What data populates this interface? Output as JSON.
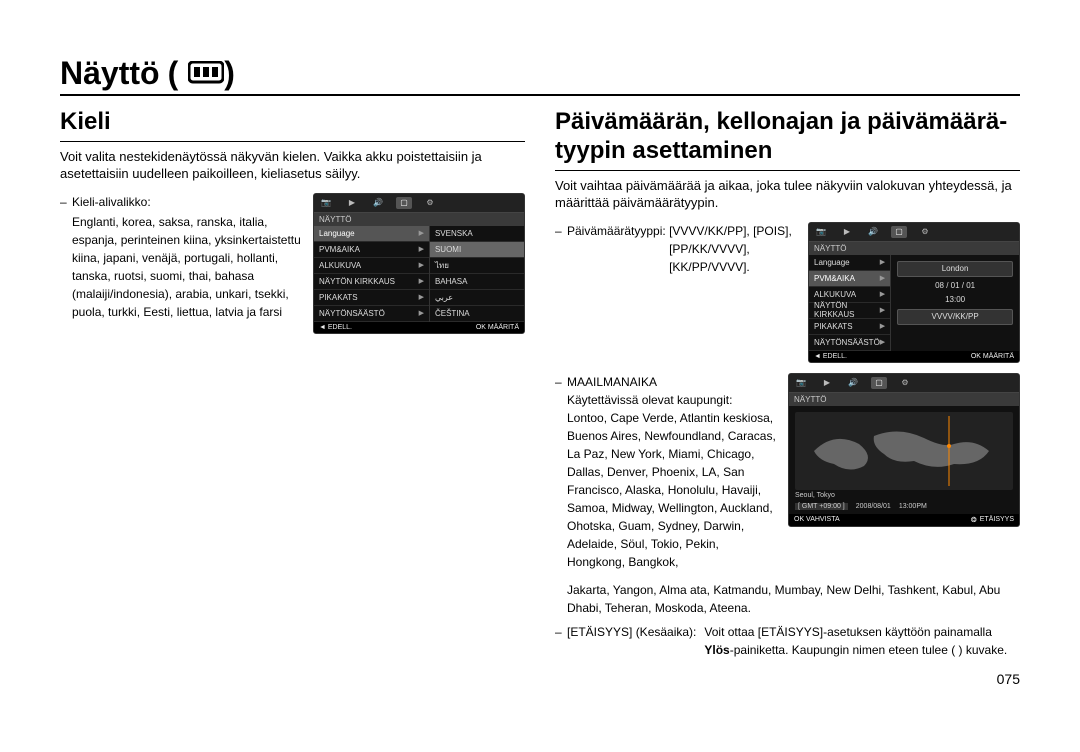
{
  "page_title": "Näyttö",
  "page_number": "075",
  "left": {
    "heading": "Kieli",
    "intro": "Voit valita nestekidenäytössä näkyvän kielen. Vaikka akku poistettaisiin ja asetettaisiin uudelleen paikoilleen, kieliasetus säilyy.",
    "subtitle": "Kieli-alivalikko:",
    "languages": "Englanti, korea, saksa, ranska, italia, espanja, perinteinen kiina, yksinkertaistettu kiina, japani, venäjä, portugali, hollanti, tanska, ruotsi, suomi, thai, bahasa (malaiji/indonesia), arabia, unkari, tsekki, puola, turkki, Eesti, liettua, latvia ja farsi"
  },
  "right": {
    "heading": "Päivämäärän, kellonajan ja päivämäärä­tyypin asettaminen",
    "intro": "Voit vaihtaa päivämäärää ja aikaa, joka tulee näkyviin valokuvan yhteydessä, ja määrittää päivämäärätyypin.",
    "date_type_label": "Päivämäärätyyppi:",
    "date_type_values": [
      "[VVVV/KK/PP], [POIS],",
      "[PP/KK/VVVV],",
      "[KK/PP/VVVV]."
    ],
    "world_label": "MAAILMANAIKA",
    "cities_label": "Käytettävissä olevat kaupungit:",
    "cities": "Lontoo, Cape Verde, Atlantin keskiosa, Buenos Aires, Newfoundland, Caracas, La Paz, New York, Miami, Chicago, Dallas, Denver, Phoenix, LA, San Francisco, Alaska, Honolulu, Havaiji, Samoa, Midway, Wellington, Auckland, Ohotska, Guam, Sydney, Darwin, Adelaide, Söul, Tokio, Pekin, Hongkong, Bangkok,",
    "cities_wide": "Jakarta, Yangon, Alma ata, Katmandu, Mumbay, New Delhi, Tashkent, Kabul, Abu Dhabi, Teheran, Moskoda, Ateena.",
    "etai_label": "[ETÄISYYS] (Kesäaika):",
    "etai_text1": "Voit ottaa [ETÄISYYS]-asetuksen käyttöön painamalla ",
    "etai_bold": "Ylös",
    "etai_text2": "-painiketta. Kaupungin nimen eteen tulee (  ) kuvake."
  },
  "lcd1": {
    "header": "NÄYTTÖ",
    "left_rows": [
      "Language",
      "PVM&AIKA",
      "ALKUKUVA",
      "NÄYTÖN KIRKKAUS",
      "PIKAKATS",
      "NÄYTÖNSÄÄSTÖ"
    ],
    "right_rows": [
      "SVENSKA",
      "SUOMI",
      "ไทย",
      "BAHASA",
      "ﻋﺮﺑﻲ",
      "ČEŠTINA"
    ],
    "foot_left": "◄  EDELL.",
    "foot_right": "OK  MÄÄRITÄ"
  },
  "lcd2": {
    "header": "NÄYTTÖ",
    "left_rows": [
      "Language",
      "PVM&AIKA",
      "ALKUKUVA",
      "NÄYTÖN KIRKKAUS",
      "PIKAKATS",
      "NÄYTÖNSÄÄSTÖ"
    ],
    "right_vals": [
      "London",
      "08 / 01 / 01",
      "13:00",
      "VVVV/KK/PP"
    ],
    "foot_left": "◄  EDELL.",
    "foot_right": "OK  MÄÄRITÄ"
  },
  "lcd3": {
    "city": "Seoul, Tokyo",
    "gmt": "[ GMT +09:00 ]",
    "date": "2008/08/01",
    "time": "13:00PM",
    "foot_left": "OK  VAHVISTA",
    "foot_right": "ETÄISYYS"
  }
}
